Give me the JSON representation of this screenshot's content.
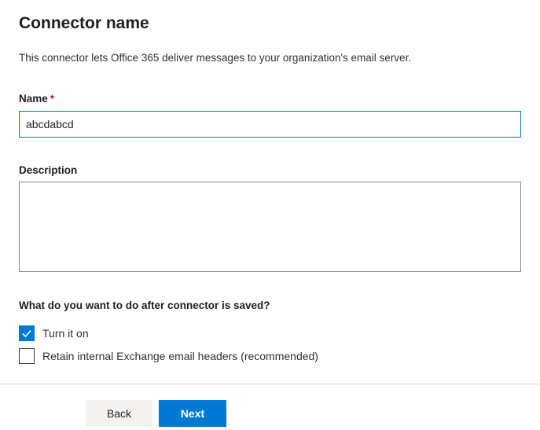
{
  "page": {
    "title": "Connector name",
    "description": "This connector lets Office 365 deliver messages to your organization's email server."
  },
  "form": {
    "name_label": "Name",
    "required_marker": "*",
    "name_value": "abcdabcd",
    "description_label": "Description",
    "description_value": ""
  },
  "options": {
    "heading": "What do you want to do after connector is saved?",
    "items": [
      {
        "label": "Turn it on",
        "checked": true
      },
      {
        "label": "Retain internal Exchange email headers (recommended)",
        "checked": false
      }
    ]
  },
  "footer": {
    "back_label": "Back",
    "next_label": "Next"
  },
  "colors": {
    "accent": "#0078d4",
    "required": "#a4262c"
  }
}
